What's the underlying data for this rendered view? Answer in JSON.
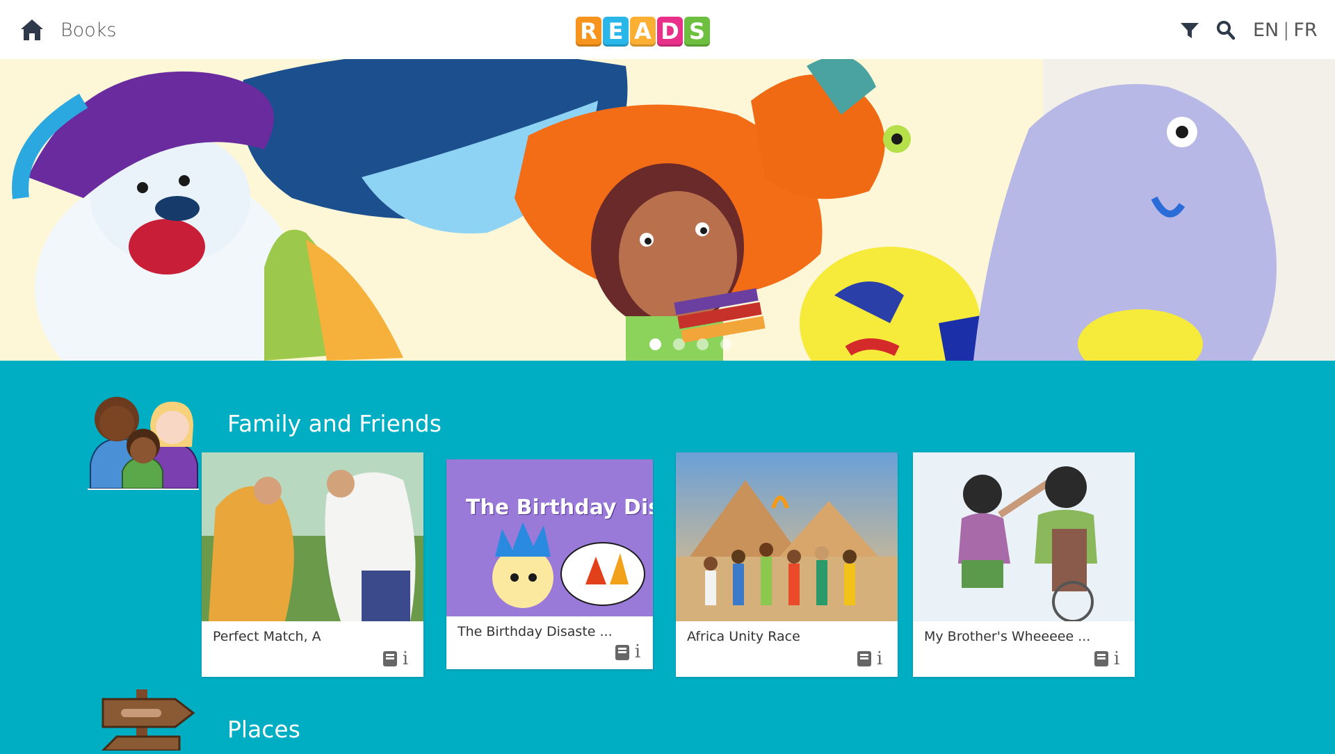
{
  "header": {
    "home_icon": "home-icon",
    "books_label": "Books",
    "logo_letters": [
      {
        "letter": "R",
        "color": "#f7941d"
      },
      {
        "letter": "E",
        "color": "#29b6e8"
      },
      {
        "letter": "A",
        "color": "#fbb034"
      },
      {
        "letter": "D",
        "color": "#e8308a"
      },
      {
        "letter": "S",
        "color": "#6cbf3f"
      }
    ],
    "filter_icon": "filter-icon",
    "search_icon": "search-icon",
    "lang_en": "EN",
    "lang_sep": "|",
    "lang_fr": "FR"
  },
  "hero": {
    "slide_count": 4,
    "active_slide": 1
  },
  "sections": [
    {
      "title": "Family and Friends",
      "icon": "family-icon",
      "books": [
        {
          "title": "Perfect Match, A"
        },
        {
          "title": "The Birthday Disaste ...",
          "cover_text": "The Birthday Disaste"
        },
        {
          "title": "Africa Unity Race"
        },
        {
          "title": "My Brother's Wheeeee ..."
        }
      ]
    },
    {
      "title": "Places",
      "icon": "signpost-icon"
    }
  ],
  "colors": {
    "background": "#00aec4",
    "topbar": "#ffffff"
  }
}
